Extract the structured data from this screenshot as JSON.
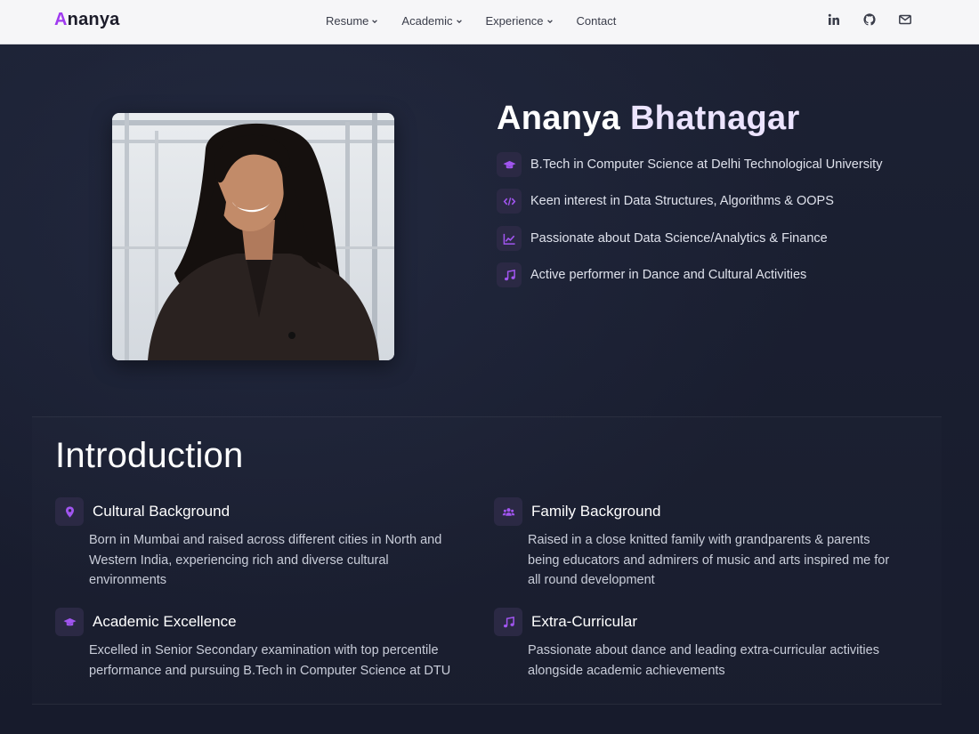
{
  "logo": {
    "first_letter": "A",
    "rest": "nanya"
  },
  "nav": {
    "items": [
      {
        "label": "Resume",
        "dropdown": true
      },
      {
        "label": "Academic",
        "dropdown": true
      },
      {
        "label": "Experience",
        "dropdown": true
      },
      {
        "label": "Contact",
        "dropdown": false
      }
    ]
  },
  "social": [
    "linkedin-icon",
    "github-icon",
    "mail-icon"
  ],
  "hero": {
    "first_name": "Ananya",
    "last_name": "Bhatnagar",
    "facts": [
      {
        "icon": "graduation-cap-icon",
        "text": "B.Tech in Computer Science at Delhi Technological University"
      },
      {
        "icon": "code-icon",
        "text": "Keen interest in Data Structures, Algorithms & OOPS"
      },
      {
        "icon": "chart-line-icon",
        "text": "Passionate about Data Science/Analytics & Finance"
      },
      {
        "icon": "music-icon",
        "text": "Active performer in Dance and Cultural Activities"
      }
    ]
  },
  "intro": {
    "title": "Introduction",
    "cards": [
      {
        "icon": "map-pin-icon",
        "title": "Cultural Background",
        "lines": [
          "Born in Mumbai and raised across different cities in North and",
          "Western India, experiencing rich and diverse cultural",
          "environments"
        ]
      },
      {
        "icon": "users-icon",
        "title": "Family Background",
        "lines": [
          "Raised in a close knitted family with grandparents & parents",
          "being educators and admirers of music and arts inspired me for",
          "all round development"
        ]
      },
      {
        "icon": "graduation-cap-icon",
        "title": "Academic Excellence",
        "lines": [
          "Excelled in Senior Secondary examination with top percentile",
          "performance and pursuing B.Tech in Computer Science at DTU"
        ]
      },
      {
        "icon": "music-icon",
        "title": "Extra-Curricular",
        "lines": [
          "Passionate about dance and leading extra-curricular activities",
          "alongside academic achievements"
        ]
      }
    ]
  },
  "colors": {
    "accent": "#a155f0",
    "background": "#181c2e",
    "navbar": "#f6f6f8"
  }
}
